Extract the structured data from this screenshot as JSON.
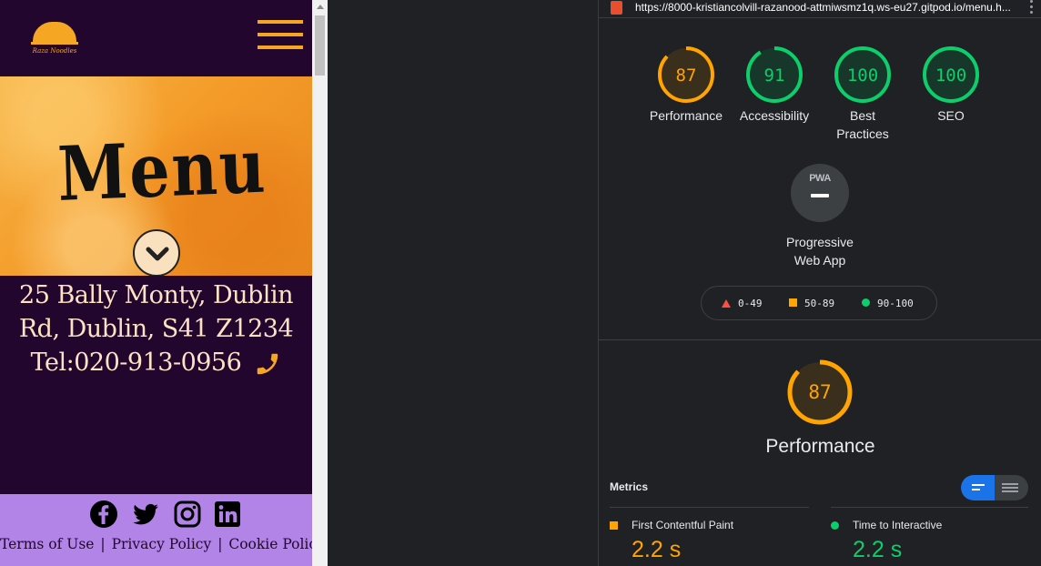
{
  "mobile": {
    "logo_text": "Raza Noodles",
    "hero_title": "Menu",
    "address_lines": [
      "25 Bally Monty, Dublin",
      "Rd, Dublin, S41 Z1234"
    ],
    "phone_text": "Tel:020-913-0956",
    "footer": {
      "terms": "Terms of Use",
      "privacy": "Privacy Policy",
      "cookie": "Cookie Policy",
      "sep": "|"
    },
    "colors": {
      "bg": "#22062e",
      "accent": "#f5a623",
      "footer_bg": "#b284e7",
      "text": "#fde3c3"
    },
    "icons": [
      "facebook-icon",
      "twitter-icon",
      "instagram-icon",
      "linkedin-icon",
      "phone-icon",
      "chevron-down-icon",
      "hamburger-icon"
    ]
  },
  "lighthouse": {
    "url": "https://8000-kristiancolvill-razanood-attmiwsmz1q.ws-eu27.gitpod.io/menu.h...",
    "scores": [
      {
        "label": "Performance",
        "value": "87",
        "score": 87,
        "status": "average"
      },
      {
        "label": "Accessibility",
        "value": "91",
        "score": 91,
        "status": "pass"
      },
      {
        "label": "Best Practices",
        "value": "100",
        "score": 100,
        "status": "pass"
      },
      {
        "label": "SEO",
        "value": "100",
        "score": 100,
        "status": "pass"
      }
    ],
    "pwa": {
      "badge": "PWA",
      "label": "Progressive Web App"
    },
    "legend": {
      "fail": "0-49",
      "average": "50-89",
      "pass": "90-100"
    },
    "performance": {
      "value": "87",
      "score": 87,
      "title": "Performance"
    },
    "metrics_title": "Metrics",
    "metrics": [
      {
        "name": "First Contentful Paint",
        "value": "2.2 s",
        "status": "average"
      },
      {
        "name": "Time to Interactive",
        "value": "2.2 s",
        "status": "pass"
      }
    ],
    "colors": {
      "pass": "#0cce6b",
      "average": "#ffa400",
      "fail": "#ff4e42",
      "pass_bg": "#16372a",
      "average_bg": "#3a2f1c"
    }
  }
}
